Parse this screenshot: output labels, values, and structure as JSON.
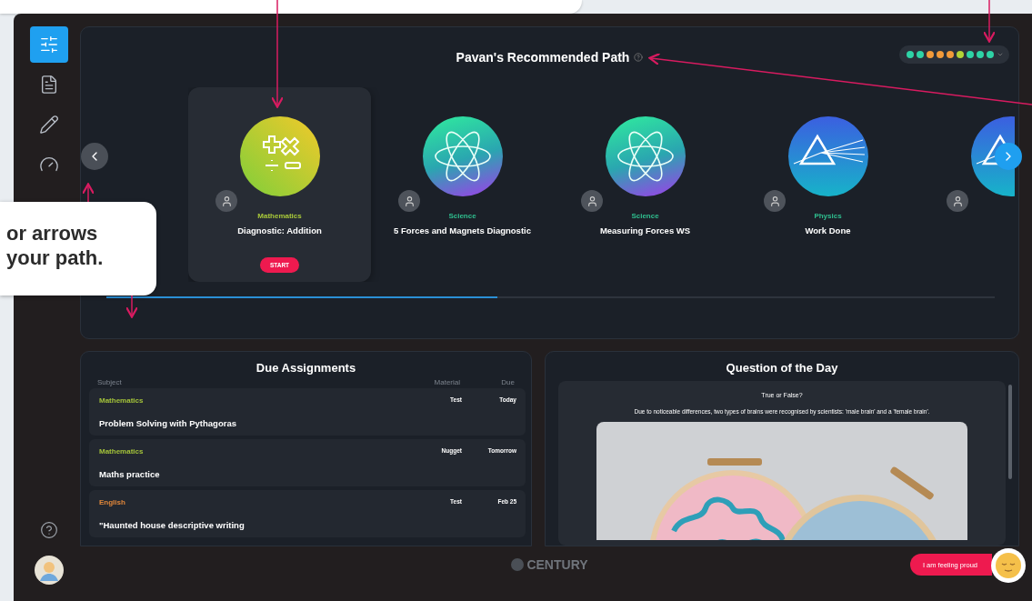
{
  "sidebar": {
    "items": [
      {
        "kind": "sliders",
        "selected": true
      },
      {
        "kind": "document",
        "selected": false
      },
      {
        "kind": "pencil",
        "selected": false
      },
      {
        "kind": "gauge",
        "selected": false
      }
    ]
  },
  "callout": {
    "lines": [
      "or arrows",
      "your path."
    ]
  },
  "path": {
    "title": "Pavan's Recommended Path",
    "progress_dots": [
      {
        "color": "#2ed3a6"
      },
      {
        "color": "#2ed3a6"
      },
      {
        "color": "#f29a3a"
      },
      {
        "color": "#f29a3a"
      },
      {
        "color": "#f29a3a"
      },
      {
        "color": "#b3d336"
      },
      {
        "color": "#2ed3a6"
      },
      {
        "color": "#2ed3a6"
      },
      {
        "color": "#2ed3a6"
      }
    ],
    "items": [
      {
        "kind": "maths",
        "subject": "Mathematics",
        "color": "#a8c83a",
        "title": "Diagnostic: Addition",
        "selected": true
      },
      {
        "kind": "atom",
        "subject": "Science",
        "color": "#2fbf8f",
        "title": "5 Forces and Magnets Diagnostic",
        "selected": false
      },
      {
        "kind": "atom",
        "subject": "Science",
        "color": "#2fbf8f",
        "title": "Measuring Forces WS",
        "selected": false
      },
      {
        "kind": "prism",
        "subject": "Physics",
        "color": "#2fbf8f",
        "title": "Work Done",
        "selected": false
      },
      {
        "kind": "prism",
        "selected": false
      }
    ],
    "action": "START",
    "progress": {
      "level": 0.44
    }
  },
  "due": {
    "title": "Due Assignments",
    "columns": [
      "Subject",
      "Material",
      "Due"
    ],
    "rows": [
      {
        "subject": "Mathematics",
        "color": "#a3c23a",
        "title": "Problem Solving with Pythagoras",
        "material": "Test",
        "due": "Today"
      },
      {
        "subject": "Mathematics",
        "color": "#a3c23a",
        "title": "Maths practice",
        "material": "Nugget",
        "due": "Tomorrow"
      },
      {
        "subject": "English",
        "color": "#e0873a",
        "title": "\"Haunted house descriptive writing",
        "material": "Test",
        "due": "Feb 25"
      }
    ]
  },
  "question": {
    "title": "Question of the Day",
    "prompt": "True or False?",
    "text": "Due to noticeable differences, two types of brains were recognised by scientists: 'male brain' and a 'female brain'."
  },
  "footer": {
    "brand": "CENTURY",
    "feeling_button": "I am feeling proud"
  }
}
